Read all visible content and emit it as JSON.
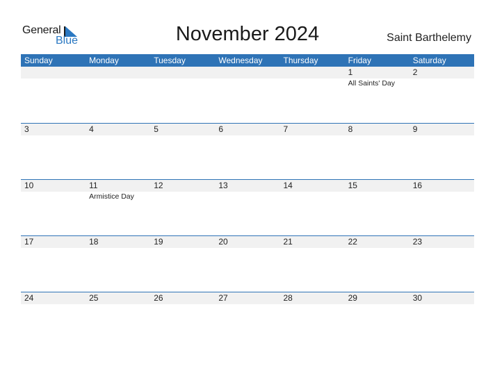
{
  "logo": {
    "text_general": "General",
    "text_blue": "Blue"
  },
  "header": {
    "title": "November 2024",
    "country": "Saint Barthelemy"
  },
  "colors": {
    "accent": "#2e73b6",
    "number_row_bg": "#f1f1f1"
  },
  "weekdays": [
    "Sunday",
    "Monday",
    "Tuesday",
    "Wednesday",
    "Thursday",
    "Friday",
    "Saturday"
  ],
  "weeks": [
    {
      "days": [
        "",
        "",
        "",
        "",
        "",
        "1",
        "2"
      ],
      "events": [
        "",
        "",
        "",
        "",
        "",
        "All Saints' Day",
        ""
      ]
    },
    {
      "days": [
        "3",
        "4",
        "5",
        "6",
        "7",
        "8",
        "9"
      ],
      "events": [
        "",
        "",
        "",
        "",
        "",
        "",
        ""
      ]
    },
    {
      "days": [
        "10",
        "11",
        "12",
        "13",
        "14",
        "15",
        "16"
      ],
      "events": [
        "",
        "Armistice Day",
        "",
        "",
        "",
        "",
        ""
      ]
    },
    {
      "days": [
        "17",
        "18",
        "19",
        "20",
        "21",
        "22",
        "23"
      ],
      "events": [
        "",
        "",
        "",
        "",
        "",
        "",
        ""
      ]
    },
    {
      "days": [
        "24",
        "25",
        "26",
        "27",
        "28",
        "29",
        "30"
      ],
      "events": [
        "",
        "",
        "",
        "",
        "",
        "",
        ""
      ]
    }
  ]
}
